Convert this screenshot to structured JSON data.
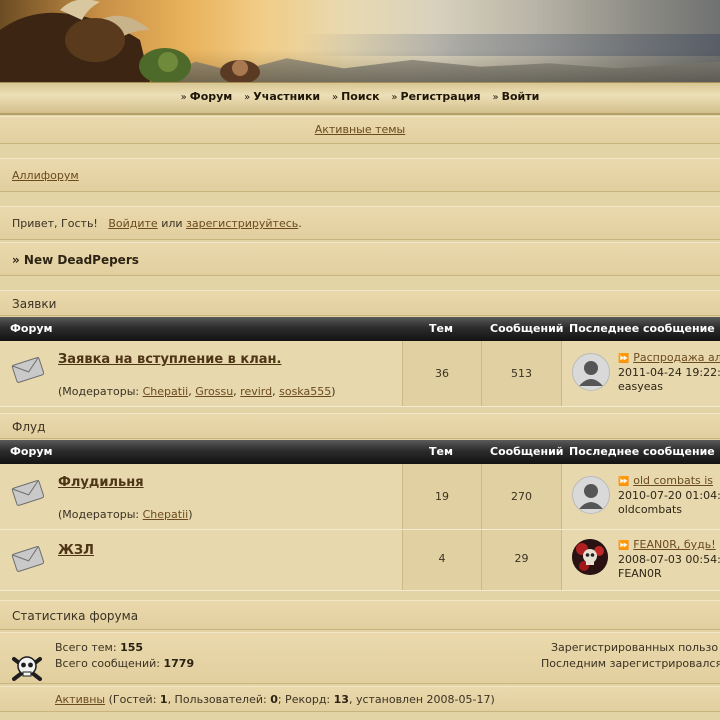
{
  "nav": {
    "items": [
      {
        "label": "Форум"
      },
      {
        "label": "Участники"
      },
      {
        "label": "Поиск"
      },
      {
        "label": "Регистрация"
      },
      {
        "label": "Войти"
      }
    ]
  },
  "active_topics": "Активные темы",
  "breadcrumb": "Аллифорум",
  "greeting": {
    "prefix": "Привет, Гость!",
    "login": "Войдите",
    "or": "или",
    "register": "зарегистрируйтесь",
    "suffix": "."
  },
  "board_title": "» New DeadPepers",
  "table_headers": {
    "forum": "Форум",
    "topics": "Тем",
    "posts": "Сообщений",
    "last": "Последнее сообщение"
  },
  "categories": [
    {
      "title": "Заявки",
      "forums": [
        {
          "name": "Заявка на вступление в клан.",
          "mods_prefix": "(Модераторы:",
          "mods": [
            "Chepatii",
            "Grossu",
            "revird",
            "soska555"
          ],
          "mods_suffix": ")",
          "topics": "36",
          "posts": "513",
          "last_title": "Распродажа ал",
          "last_date": "2011-04-24 19:22:",
          "last_user": "easyeas"
        }
      ]
    },
    {
      "title": "Флуд",
      "forums": [
        {
          "name": "Флудильня",
          "mods_prefix": "(Модераторы:",
          "mods": [
            "Chepatii"
          ],
          "mods_suffix": ")",
          "topics": "19",
          "posts": "270",
          "last_title": "old combats is",
          "last_date": "2010-07-20 01:04:",
          "last_user": "oldcombats"
        },
        {
          "name": "ЖЗЛ",
          "topics": "4",
          "posts": "29",
          "last_title": "FEAN0R, будь!",
          "last_date": "2008-07-03 00:54:",
          "last_user": "FEAN0R"
        }
      ]
    }
  ],
  "stats": {
    "title": "Статистика форума",
    "total_topics_label": "Всего тем:",
    "total_topics": "155",
    "total_posts_label": "Всего сообщений:",
    "total_posts": "1779",
    "registered_label": "Зарегистрированных пользо",
    "last_registered_label": "Последним зарегистрировался",
    "active_link": "Активны",
    "guests_label": "(Гостей:",
    "guests": "1",
    "users_label": ", Пользователей:",
    "users": "0",
    "record_label": "; Рекорд:",
    "record": "13",
    "record_date_label": ", установлен 2008-05-17)"
  },
  "colors": {
    "page_bg": "#e3d4a6",
    "header_bar": "#1a1a1a",
    "link": "#6b4a1e"
  },
  "icons": {
    "nav_arrow": "double-chevron-right",
    "forum_icon": "envelope-icon",
    "last_post_icon": "goto-post-icon",
    "stats_icon": "skull-crossbones-icon"
  }
}
